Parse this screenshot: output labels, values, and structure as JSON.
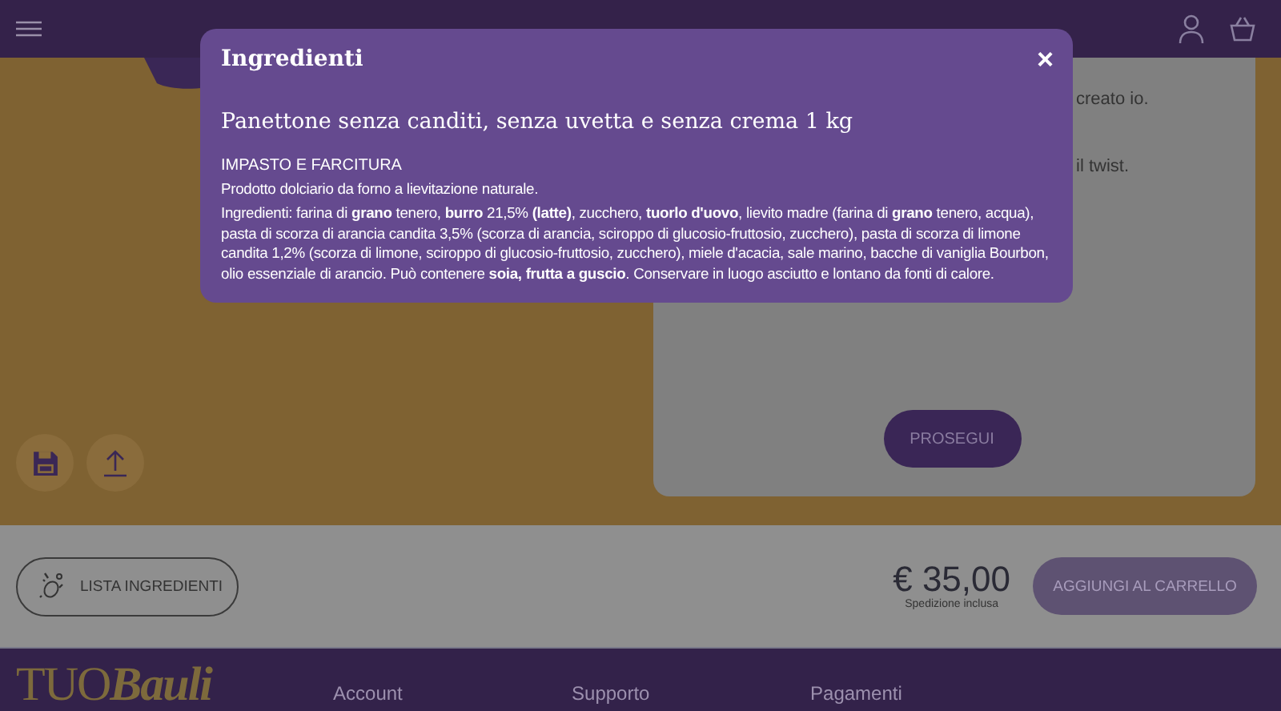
{
  "configurator": {
    "card_texts": [
      "creato io.",
      "il twist."
    ],
    "continue_button": "PROSEGUI"
  },
  "purchase_bar": {
    "ingredients_button": "LISTA INGREDIENTI",
    "price": "€ 35,00",
    "shipping_note": "Spedizione inclusa",
    "add_to_cart_button": "AGGIUNGI AL CARRELLO"
  },
  "footer": {
    "logo": "TUO**Bauli**",
    "links": [
      "Account",
      "Supporto",
      "Pagamenti"
    ]
  },
  "modal": {
    "title": "Ingredienti",
    "close": "×",
    "product_name": "Panettone senza canditi, senza uvetta e senza crema 1 kg",
    "section_heading": "IMPASTO E FARCITURA",
    "paragraphs": [
      "Prodotto dolciario da forno a lievitazione naturale.",
      "Ingredienti: farina di **grano** tenero, **burro** 21,5% **(latte)**, zucchero, **tuorlo d'uovo**, lievito madre (farina di **grano** tenero, acqua), pasta di scorza di arancia candita 3,5% (scorza di arancia, sciroppo di glucosio-fruttosio, zucchero), pasta di scorza di limone candita 1,2% (scorza di limone, sciroppo di glucosio-fruttosio, zucchero), miele d'acacia, sale marino, bacche di vaniglia Bourbon, olio essenziale di arancio. Può contenere **soia, frutta a guscio**. Conservare in luogo asciutto e lontano da fonti di calore."
    ]
  }
}
